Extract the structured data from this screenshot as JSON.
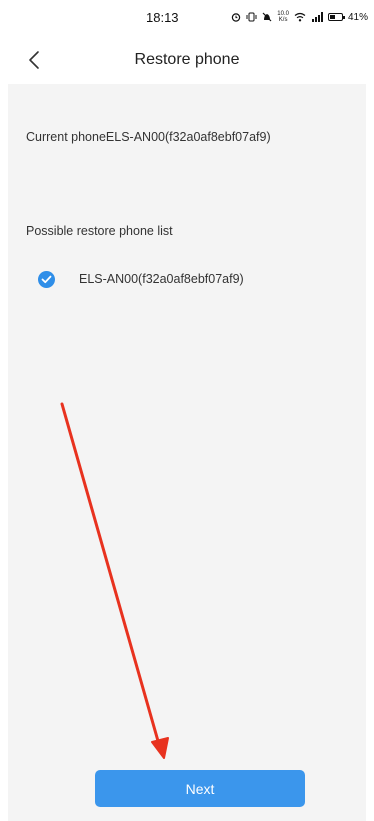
{
  "status_bar": {
    "time": "18:13",
    "net_speed": "10.0",
    "net_speed_unit": "K/s",
    "battery": "41%",
    "icons": [
      "alarm-icon",
      "vibrate-icon",
      "mute-icon",
      "data-speed-icon",
      "wifi-icon",
      "signal-icon",
      "battery-icon"
    ]
  },
  "header": {
    "title": "Restore phone",
    "back_icon": "chevron-left-icon"
  },
  "current_phone": "Current phoneELS-AN00(f32a0af8ebf07af9)",
  "restore_list": {
    "title": "Possible restore phone list",
    "items": [
      {
        "label": "ELS-AN00(f32a0af8ebf07af9)",
        "selected": true
      }
    ]
  },
  "footer": {
    "next_label": "Next"
  },
  "colors": {
    "accent": "#3b96ec",
    "check": "#2f8ee8",
    "annotation_arrow": "#e8321f",
    "background": "#f4f4f4"
  }
}
